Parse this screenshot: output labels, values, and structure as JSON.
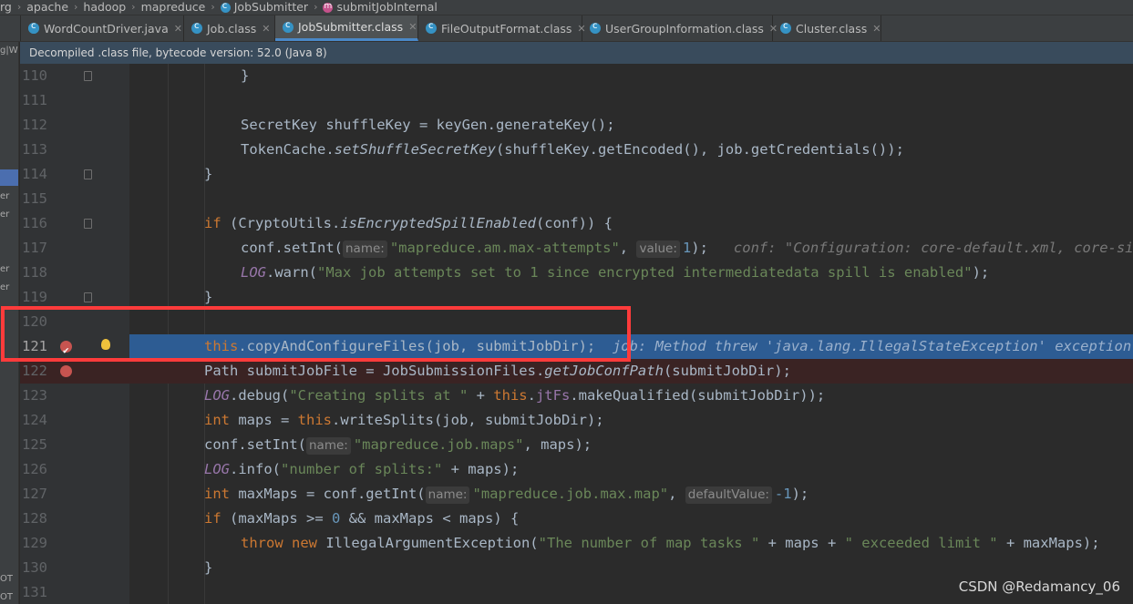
{
  "breadcrumb": [
    "rg",
    "apache",
    "hadoop",
    "mapreduce",
    "JobSubmitter",
    "submitJobInternal"
  ],
  "tabs": [
    {
      "label": "WordCountDriver.java",
      "active": false
    },
    {
      "label": "Job.class",
      "active": false
    },
    {
      "label": "JobSubmitter.class",
      "active": true
    },
    {
      "label": "FileOutputFormat.class",
      "active": false
    },
    {
      "label": "UserGroupInformation.class",
      "active": false
    },
    {
      "label": "Cluster.class",
      "active": false
    }
  ],
  "banner": "Decompiled .class file, bytecode version: 52.0 (Java 8)",
  "left_fragments": [
    "g|W",
    "er",
    "er",
    "er",
    "er",
    "OT",
    "OT"
  ],
  "lines": {
    "n110": "110",
    "n111": "111",
    "n112": "112",
    "n113": "113",
    "n114": "114",
    "n115": "115",
    "n116": "116",
    "n117": "117",
    "n118": "118",
    "n119": "119",
    "n120": "120",
    "n121": "121",
    "n122": "122",
    "n123": "123",
    "n124": "124",
    "n125": "125",
    "n126": "126",
    "n127": "127",
    "n128": "128",
    "n129": "129",
    "n130": "130",
    "n131": "131"
  },
  "code": {
    "l112": "SecretKey shuffleKey = keyGen.generateKey();",
    "l113_a": "TokenCache.",
    "l113_b": "setShuffleSecretKey",
    "l113_c": "(shuffleKey.getEncoded(), job.getCredentials());",
    "l116_kw": "if",
    "l116_a": " (CryptoUtils.",
    "l116_b": "isEncryptedSpillEnabled",
    "l116_c": "(conf)) {",
    "l117_a": "conf.setInt(",
    "l117_hint1": "name:",
    "l117_str": "\"mapreduce.am.max-attempts\"",
    "l117_comma": ", ",
    "l117_hint2": "value:",
    "l117_num": "1",
    "l117_end": ");",
    "l117_inline": "conf: \"Configuration: core-default.xml, core-site.xml, mapred-default.xml, mapred-site.xml\"",
    "l118_const": "LOG",
    "l118_a": ".warn(",
    "l118_str": "\"Max job attempts set to 1 since encrypted intermediatedata spill is enabled\"",
    "l118_end": ");",
    "l121_this": "this",
    "l121_a": ".copyAndConfigureFiles(job, submitJobDir);",
    "l121_inline": "job: Method threw 'java.lang.IllegalStateException' exception. Cannot evaluate",
    "l122_a": "Path submitJobFile = JobSubmissionFiles.",
    "l122_b": "getJobConfPath",
    "l122_c": "(submitJobDir);",
    "l123_const": "LOG",
    "l123_a": ".debug(",
    "l123_str": "\"Creating splits at \"",
    "l123_b": " + ",
    "l123_this": "this",
    "l123_c": ".",
    "l123_fld": "jtFs",
    "l123_d": ".makeQualified(submitJobDir));",
    "l124_kw": "int",
    "l124_a": " maps = ",
    "l124_this": "this",
    "l124_b": ".writeSplits(job, submitJobDir);",
    "l125_a": "conf.setInt(",
    "l125_hint": "name:",
    "l125_str": "\"mapreduce.job.maps\"",
    "l125_b": ", maps);",
    "l126_const": "LOG",
    "l126_a": ".info(",
    "l126_str": "\"number of splits:\"",
    "l126_b": " + maps);",
    "l127_kw": "int",
    "l127_a": " maxMaps = conf.getInt(",
    "l127_hint1": "name:",
    "l127_str": "\"mapreduce.job.max.map\"",
    "l127_b": ", ",
    "l127_hint2": "defaultValue:",
    "l127_num": "-1",
    "l127_c": ");",
    "l128_kw": "if",
    "l128_a": " (maxMaps >= ",
    "l128_num": "0",
    "l128_b": " && maxMaps < maps) {",
    "l129_kw1": "throw",
    "l129_kw2": "new",
    "l129_a": " IllegalArgumentException(",
    "l129_str1": "\"The number of map tasks \"",
    "l129_b": " + maps + ",
    "l129_str2": "\" exceeded limit \"",
    "l129_c": " + maxMaps);",
    "brace": "}",
    "brace_open": "{"
  },
  "watermark": "CSDN @Redamancy_06",
  "colors": {
    "highlight": "#2d5c93",
    "annotation": "#ff3b3b",
    "breakpoint": "#c75450"
  }
}
